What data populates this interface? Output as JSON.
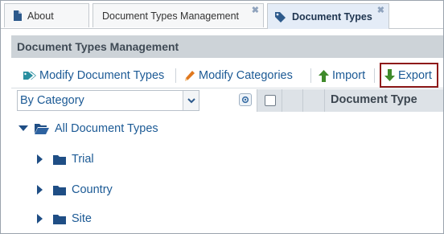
{
  "tabs": [
    {
      "label": "About",
      "icon": "document-icon",
      "closable": false
    },
    {
      "label": "Document Types Management",
      "icon": "none",
      "closable": true
    },
    {
      "label": "Document Types",
      "icon": "tag-icon",
      "closable": true,
      "active": true
    }
  ],
  "close_glyph": "✖",
  "panel": {
    "title": "Document Types Management"
  },
  "toolbar": {
    "modify_types": "Modify Document Types",
    "modify_categories": "Modify Categories",
    "import": "Import",
    "export": "Export"
  },
  "filter": {
    "selected": "By Category"
  },
  "grid": {
    "columns": [
      "Document Type"
    ]
  },
  "tree": {
    "root": "All Document Types",
    "children": [
      "Trial",
      "Country",
      "Site"
    ]
  },
  "colors": {
    "link": "#1c5a95",
    "folder": "#1f4e85",
    "export_highlight": "#8e1a1a",
    "import_arrow": "#3f8a2a",
    "export_arrow": "#3f8a2a",
    "pencil": "#e0781e",
    "tag": "#2a8fa0"
  }
}
